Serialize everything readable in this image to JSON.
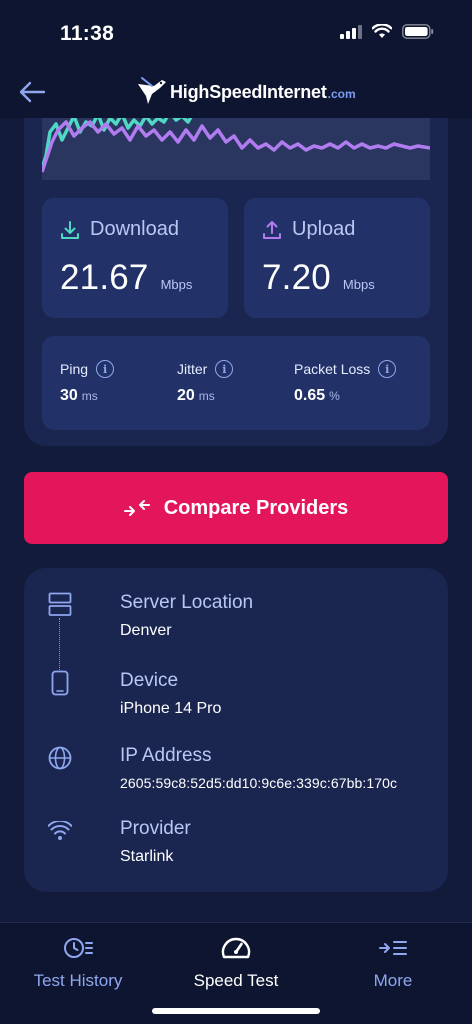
{
  "status_bar": {
    "time": "11:38"
  },
  "header": {
    "logo_main": "HighSpeedInternet",
    "logo_suffix": ".com"
  },
  "results": {
    "download": {
      "label": "Download",
      "value": "21.67",
      "unit": "Mbps"
    },
    "upload": {
      "label": "Upload",
      "value": "7.20",
      "unit": "Mbps"
    },
    "stats": [
      {
        "label": "Ping",
        "value": "30",
        "unit": "ms"
      },
      {
        "label": "Jitter",
        "value": "20",
        "unit": "ms"
      },
      {
        "label": "Packet Loss",
        "value": "0.65",
        "unit": "%"
      }
    ]
  },
  "compare_button": {
    "label": "Compare Providers"
  },
  "details": [
    {
      "title": "Server Location",
      "value": "Denver",
      "icon": "server-icon"
    },
    {
      "title": "Device",
      "value": "iPhone 14 Pro",
      "icon": "phone-icon"
    },
    {
      "title": "IP Address",
      "value": "2605:59c8:52d5:dd10:9c6e:339c:67bb:170c",
      "icon": "globe-icon"
    },
    {
      "title": "Provider",
      "value": "Starlink",
      "icon": "wifi-icon"
    }
  ],
  "tabs": [
    {
      "label": "Test History",
      "icon": "history-icon"
    },
    {
      "label": "Speed Test",
      "icon": "speedometer-icon",
      "active": true
    },
    {
      "label": "More",
      "icon": "more-icon"
    }
  ],
  "colors": {
    "accent": "#e3165b",
    "download_line": "#4fd8c4",
    "upload_line": "#b07cf0",
    "icon_blue": "#8fa7ee"
  }
}
